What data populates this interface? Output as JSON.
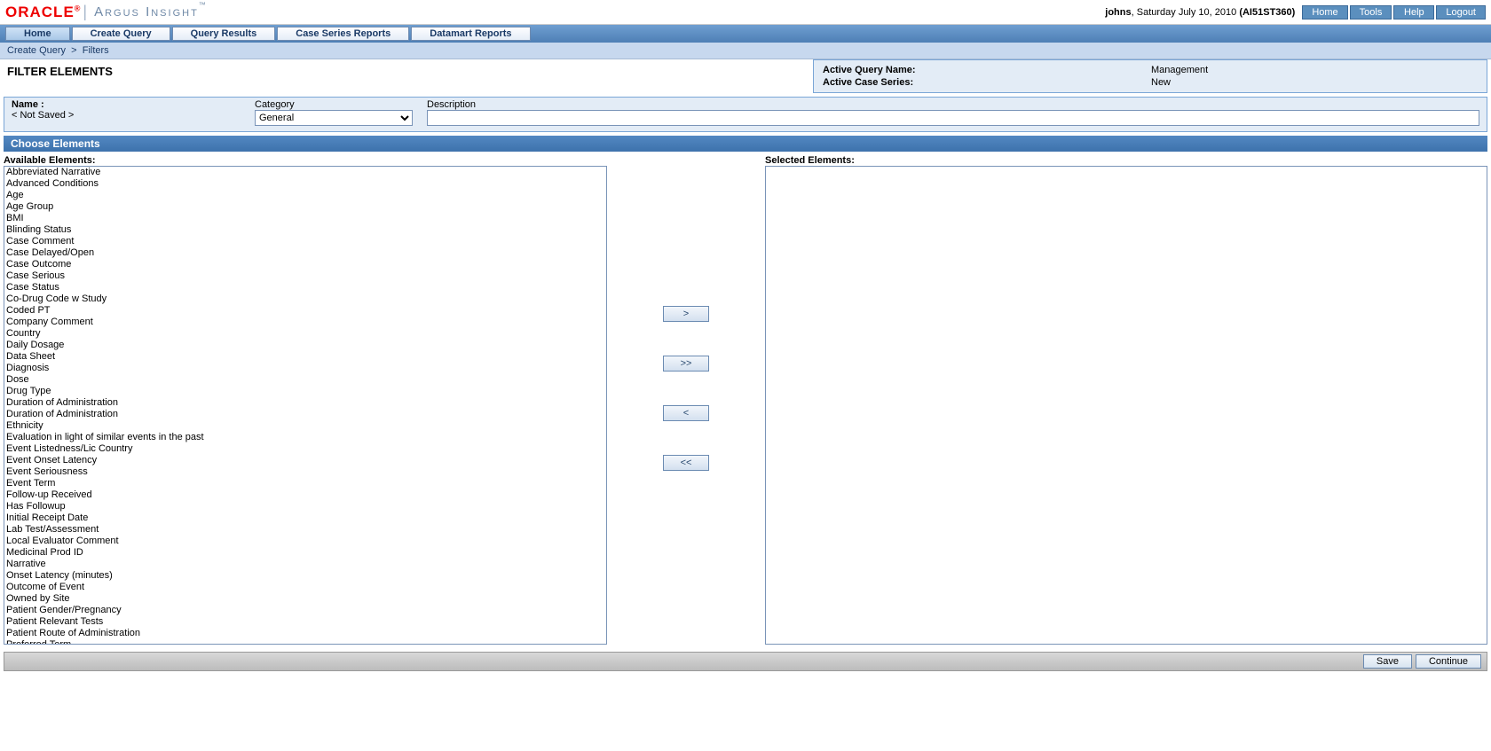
{
  "brand": {
    "oracle": "ORACLE",
    "argus": "Argus Insight"
  },
  "user": {
    "name": "johns",
    "date": "Saturday July 10, 2010",
    "code": "(AI51ST360)"
  },
  "topButtons": {
    "home": "Home",
    "tools": "Tools",
    "help": "Help",
    "logout": "Logout"
  },
  "nav": {
    "home": "Home",
    "createQuery": "Create Query",
    "queryResults": "Query Results",
    "caseSeries": "Case Series Reports",
    "datamart": "Datamart Reports"
  },
  "breadcrumb": {
    "a": "Create Query",
    "sep": ">",
    "b": "Filters"
  },
  "pageTitle": "FILTER ELEMENTS",
  "active": {
    "queryLabel": "Active Query Name:",
    "queryVal": "Management",
    "seriesLabel": "Active Case Series:",
    "seriesVal": "New"
  },
  "form": {
    "nameLabel": "Name :",
    "nameValue": "< Not Saved >",
    "categoryLabel": "Category",
    "categoryValue": "General",
    "descriptionLabel": "Description",
    "descriptionValue": ""
  },
  "section": {
    "choose": "Choose Elements"
  },
  "lists": {
    "availableLabel": "Available Elements:",
    "selectedLabel": "Selected Elements:"
  },
  "moveBtns": {
    "add": ">",
    "addAll": ">>",
    "remove": "<",
    "removeAll": "<<"
  },
  "availableElements": [
    "Abbreviated Narrative",
    "Advanced Conditions",
    "Age",
    "Age Group",
    "BMI",
    "Blinding Status",
    "Case Comment",
    "Case Delayed/Open",
    "Case Outcome",
    "Case Serious",
    "Case Status",
    "Co-Drug Code w Study",
    "Coded PT",
    "Company Comment",
    "Country",
    "Daily Dosage",
    "Data Sheet",
    "Diagnosis",
    "Dose",
    "Drug Type",
    "Duration of Administration",
    "Duration of Administration",
    "Ethnicity",
    "Evaluation in light of similar events in the past",
    "Event Listedness/Lic Country",
    "Event Onset Latency",
    "Event Seriousness",
    "Event Term",
    "Follow-up Received",
    "Has Followup",
    "Initial Receipt Date",
    "Lab Test/Assessment",
    "Local Evaluator Comment",
    "Medicinal Prod ID",
    "Narrative",
    "Onset Latency (minutes)",
    "Outcome of Event",
    "Owned by Site",
    "Patient Gender/Pregnancy",
    "Patient Relevant Tests",
    "Patient Route of Administration",
    "Preferred Term"
  ],
  "footer": {
    "save": "Save",
    "continue": "Continue"
  }
}
